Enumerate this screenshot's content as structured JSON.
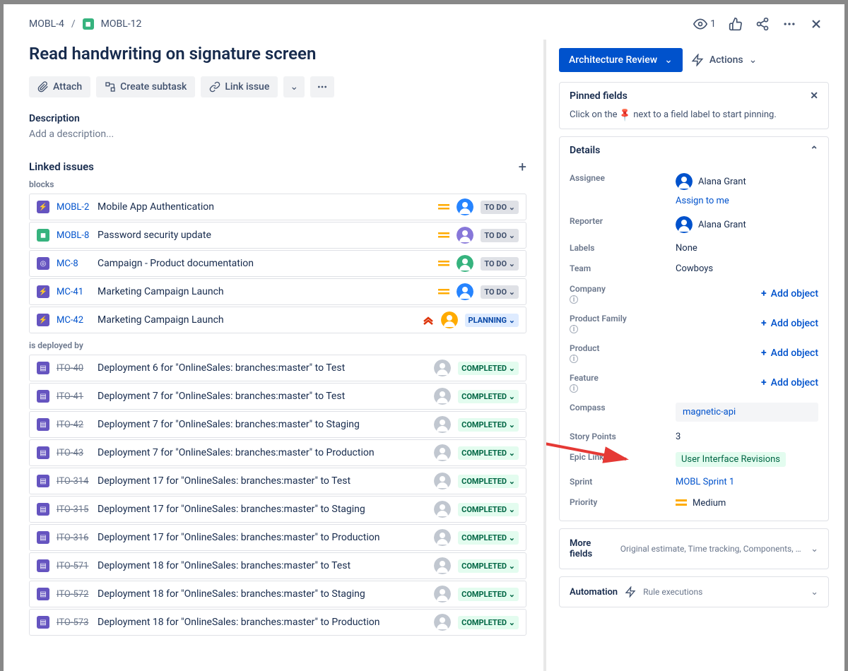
{
  "breadcrumb": {
    "parent": "MOBL-4",
    "current": "MOBL-12"
  },
  "watch_count": "1",
  "title": "Read handwriting on signature screen",
  "toolbar": {
    "attach": "Attach",
    "subtask": "Create subtask",
    "link": "Link issue"
  },
  "description_h": "Description",
  "description_ph": "Add a description...",
  "linked_h": "Linked issues",
  "group1": "blocks",
  "group2": "is deployed by",
  "blocks": [
    {
      "icon": "#6554c0",
      "glyph": "⚡",
      "key": "MOBL-2",
      "title": "Mobile App Authentication",
      "prio": "med",
      "avatar": "#2684ff",
      "status": "TO DO",
      "stclass": "st-todo"
    },
    {
      "icon": "#36b37e",
      "glyph": "◼",
      "key": "MOBL-8",
      "title": "Password security update",
      "prio": "med",
      "avatar": "#8777d9",
      "status": "TO DO",
      "stclass": "st-todo"
    },
    {
      "icon": "#6554c0",
      "glyph": "◎",
      "key": "MC-8",
      "title": "Campaign - Product documentation",
      "prio": "med",
      "avatar": "#36b37e",
      "status": "TO DO",
      "stclass": "st-todo"
    },
    {
      "icon": "#6554c0",
      "glyph": "⚡",
      "key": "MC-41",
      "title": "Marketing Campaign Launch",
      "prio": "med",
      "avatar": "#2684ff",
      "status": "TO DO",
      "stclass": "st-todo"
    },
    {
      "icon": "#6554c0",
      "glyph": "⚡",
      "key": "MC-42",
      "title": "Marketing Campaign Launch",
      "prio": "high",
      "avatar": "#ffab00",
      "status": "PLANNING",
      "stclass": "st-planning"
    }
  ],
  "deployed": [
    {
      "key": "ITO-40",
      "title": "Deployment 6 for \"OnlineSales: branches:master\" to Test"
    },
    {
      "key": "ITO-41",
      "title": "Deployment 7 for \"OnlineSales: branches:master\" to Test"
    },
    {
      "key": "ITO-42",
      "title": "Deployment 7 for \"OnlineSales: branches:master\" to Staging"
    },
    {
      "key": "ITO-43",
      "title": "Deployment 7 for \"OnlineSales: branches:master\" to Production"
    },
    {
      "key": "ITO-314",
      "title": "Deployment 17 for \"OnlineSales: branches:master\" to Test"
    },
    {
      "key": "ITO-315",
      "title": "Deployment 17 for \"OnlineSales: branches:master\" to Staging"
    },
    {
      "key": "ITO-316",
      "title": "Deployment 17 for \"OnlineSales: branches:master\" to Production"
    },
    {
      "key": "ITO-571",
      "title": "Deployment 18 for \"OnlineSales: branches:master\" to Test"
    },
    {
      "key": "ITO-572",
      "title": "Deployment 18 for \"OnlineSales: branches:master\" to Staging"
    },
    {
      "key": "ITO-573",
      "title": "Deployment 18 for \"OnlineSales: branches:master\" to Production"
    }
  ],
  "deployed_status": "COMPLETED",
  "status_btn": "Architecture Review",
  "actions_btn": "Actions",
  "pinned_h": "Pinned fields",
  "pinned_txt1": "Click on the ",
  "pinned_txt2": " next to a field label to start pinning.",
  "details_h": "Details",
  "assignee_l": "Assignee",
  "assignee_v": "Alana Grant",
  "assign_me": "Assign to me",
  "reporter_l": "Reporter",
  "reporter_v": "Alana Grant",
  "labels_l": "Labels",
  "labels_v": "None",
  "team_l": "Team",
  "team_v": "Cowboys",
  "company_l": "Company",
  "pfamily_l": "Product Family",
  "product_l": "Product",
  "feature_l": "Feature",
  "add_object": "Add object",
  "compass_l": "Compass",
  "compass_v": "magnetic-api",
  "sp_l": "Story Points",
  "sp_v": "3",
  "epic_l": "Epic Link",
  "epic_v": "User Interface Revisions",
  "sprint_l": "Sprint",
  "sprint_v": "MOBL Sprint 1",
  "priority_l": "Priority",
  "priority_v": "Medium",
  "more_l": "More fields",
  "more_v": "Original estimate, Time tracking, Components, Fix ...",
  "auto_l": "Automation",
  "auto_v": "Rule executions"
}
